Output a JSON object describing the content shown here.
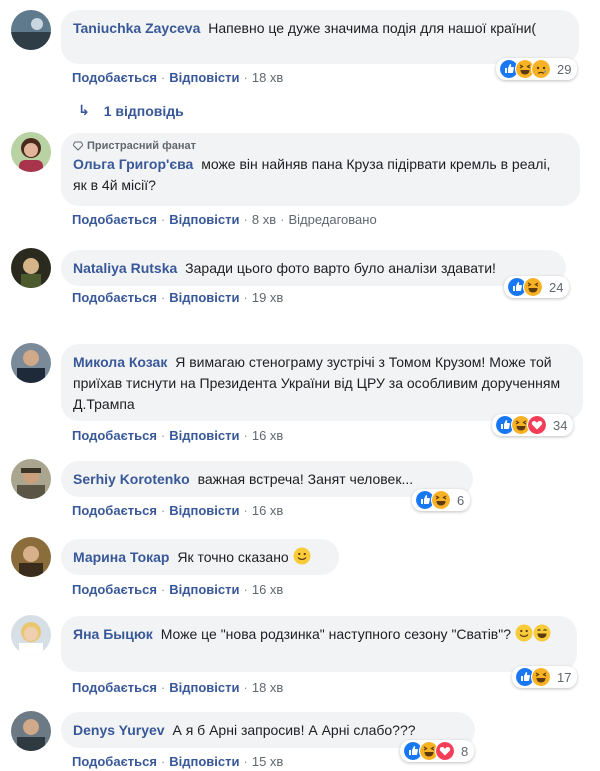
{
  "comments": [
    {
      "author": "Taniuchka Zayceva",
      "text": "Напевно це дуже значима подія для нашої країни(",
      "like": "Подобається",
      "reply": "Відповісти",
      "time": "18 хв",
      "reactions": [
        "like",
        "haha",
        "sad"
      ],
      "count": "29"
    },
    {
      "badge": "Пристрасний фанат",
      "author": "Ольга Григор'єва",
      "text": "може він найняв пана Круза підірвати кремль в реалі, як в 4й місії?",
      "like": "Подобається",
      "reply": "Відповісти",
      "time": "8 хв",
      "edited": "Відредаговано"
    },
    {
      "author": "Nataliya Rutska",
      "text": "Заради цього фото варто було аналізи здавати!",
      "like": "Подобається",
      "reply": "Відповісти",
      "time": "19 хв",
      "reactions": [
        "like",
        "haha"
      ],
      "count": "24"
    },
    {
      "author": "Микола Козак",
      "text": "Я вимагаю стенограму зустрічі з Томом Крузом! Може той приїхав тиснути на Президента України від ЦРУ за особливим дорученням Д.Трампа",
      "like": "Подобається",
      "reply": "Відповісти",
      "time": "16 хв",
      "reactions": [
        "like",
        "haha",
        "love"
      ],
      "count": "34"
    },
    {
      "author": "Serhiy Korotenko",
      "text": "важная встреча! Занят человек...",
      "like": "Подобається",
      "reply": "Відповісти",
      "time": "16 хв",
      "reactions": [
        "like",
        "haha"
      ],
      "count": "6"
    },
    {
      "author": "Марина Токар",
      "text": "Як точно сказано",
      "like": "Подобається",
      "reply": "Відповісти",
      "time": "16 хв"
    },
    {
      "author": "Яна Быцюк",
      "text": "Може це \"нова родзинка\" наступного сезону \"Сватів\"?",
      "like": "Подобається",
      "reply": "Відповісти",
      "time": "18 хв",
      "reactions": [
        "like",
        "haha"
      ],
      "count": "17"
    },
    {
      "author": "Denys Yuryev",
      "text": "А я б Арні запросив! А Арні слабо???",
      "like": "Подобається",
      "reply": "Відповісти",
      "time": "15 хв",
      "reactions": [
        "like",
        "haha",
        "love"
      ],
      "count": "8"
    }
  ],
  "replies_link": "1 відповідь",
  "colors": {
    "link": "#385898",
    "bubble": "#f2f3f5",
    "like": "#1877f2",
    "haha": "#f7b125",
    "love": "#f33e58"
  }
}
